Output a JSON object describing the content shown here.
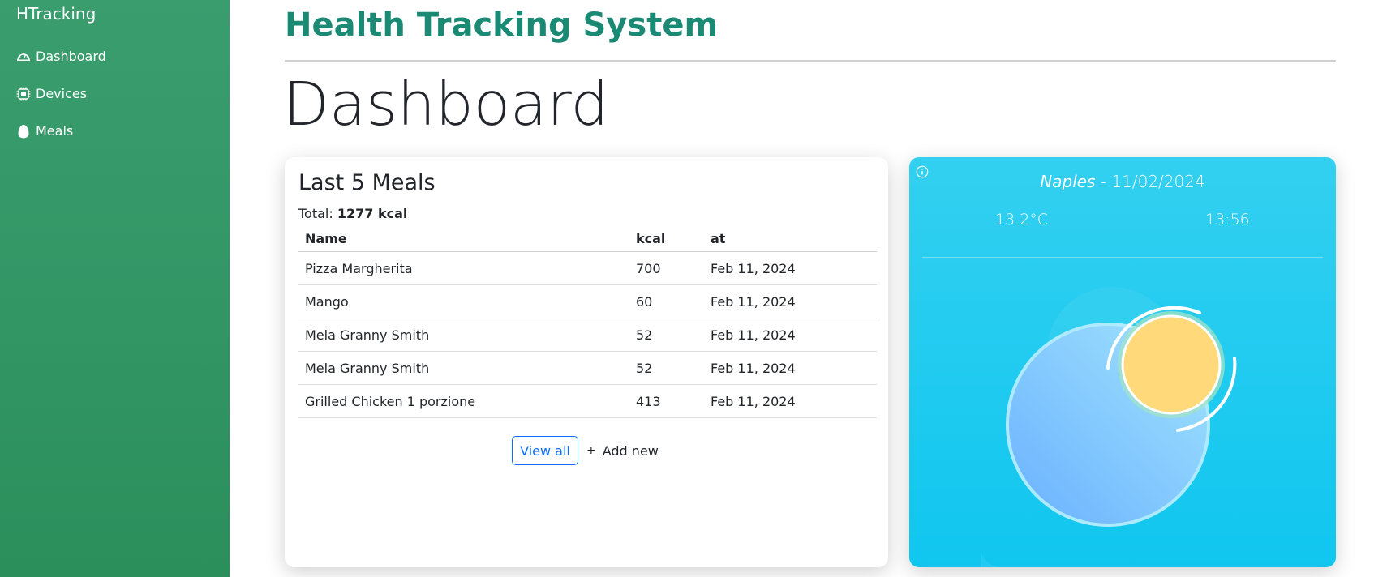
{
  "sidebar": {
    "brand": "HTracking",
    "items": [
      {
        "label": "Dashboard",
        "icon": "speedometer-icon"
      },
      {
        "label": "Devices",
        "icon": "cpu-icon"
      },
      {
        "label": "Meals",
        "icon": "egg-icon"
      }
    ]
  },
  "header": {
    "system_title": "Health Tracking System",
    "page_title": "Dashboard"
  },
  "meals_card": {
    "title": "Last 5 Meals",
    "total_label": "Total:",
    "total_value": "1277 kcal",
    "columns": [
      "Name",
      "kcal",
      "at"
    ],
    "rows": [
      {
        "name": "Pizza Margherita",
        "kcal": "700",
        "at": "Feb 11, 2024"
      },
      {
        "name": "Mango",
        "kcal": "60",
        "at": "Feb 11, 2024"
      },
      {
        "name": "Mela Granny Smith",
        "kcal": "52",
        "at": "Feb 11, 2024"
      },
      {
        "name": "Mela Granny Smith",
        "kcal": "52",
        "at": "Feb 11, 2024"
      },
      {
        "name": "Grilled Chicken 1 porzione",
        "kcal": "413",
        "at": "Feb 11, 2024"
      }
    ],
    "view_all_label": "View all",
    "add_new_label": "Add new",
    "add_icon": "plus-icon"
  },
  "weather": {
    "city": "Naples",
    "separator": " - ",
    "date": "11/02/2024",
    "temperature": "13.2°C",
    "time": "13:56",
    "info_icon": "info-icon",
    "condition_icon": "sun-behind-cloud-icon"
  },
  "colors": {
    "sidebar": "#2e9460",
    "title": "#1a8a74",
    "weather_bg": "#1fcaef",
    "sun": "#ffd97a",
    "link": "#0d6efd"
  }
}
